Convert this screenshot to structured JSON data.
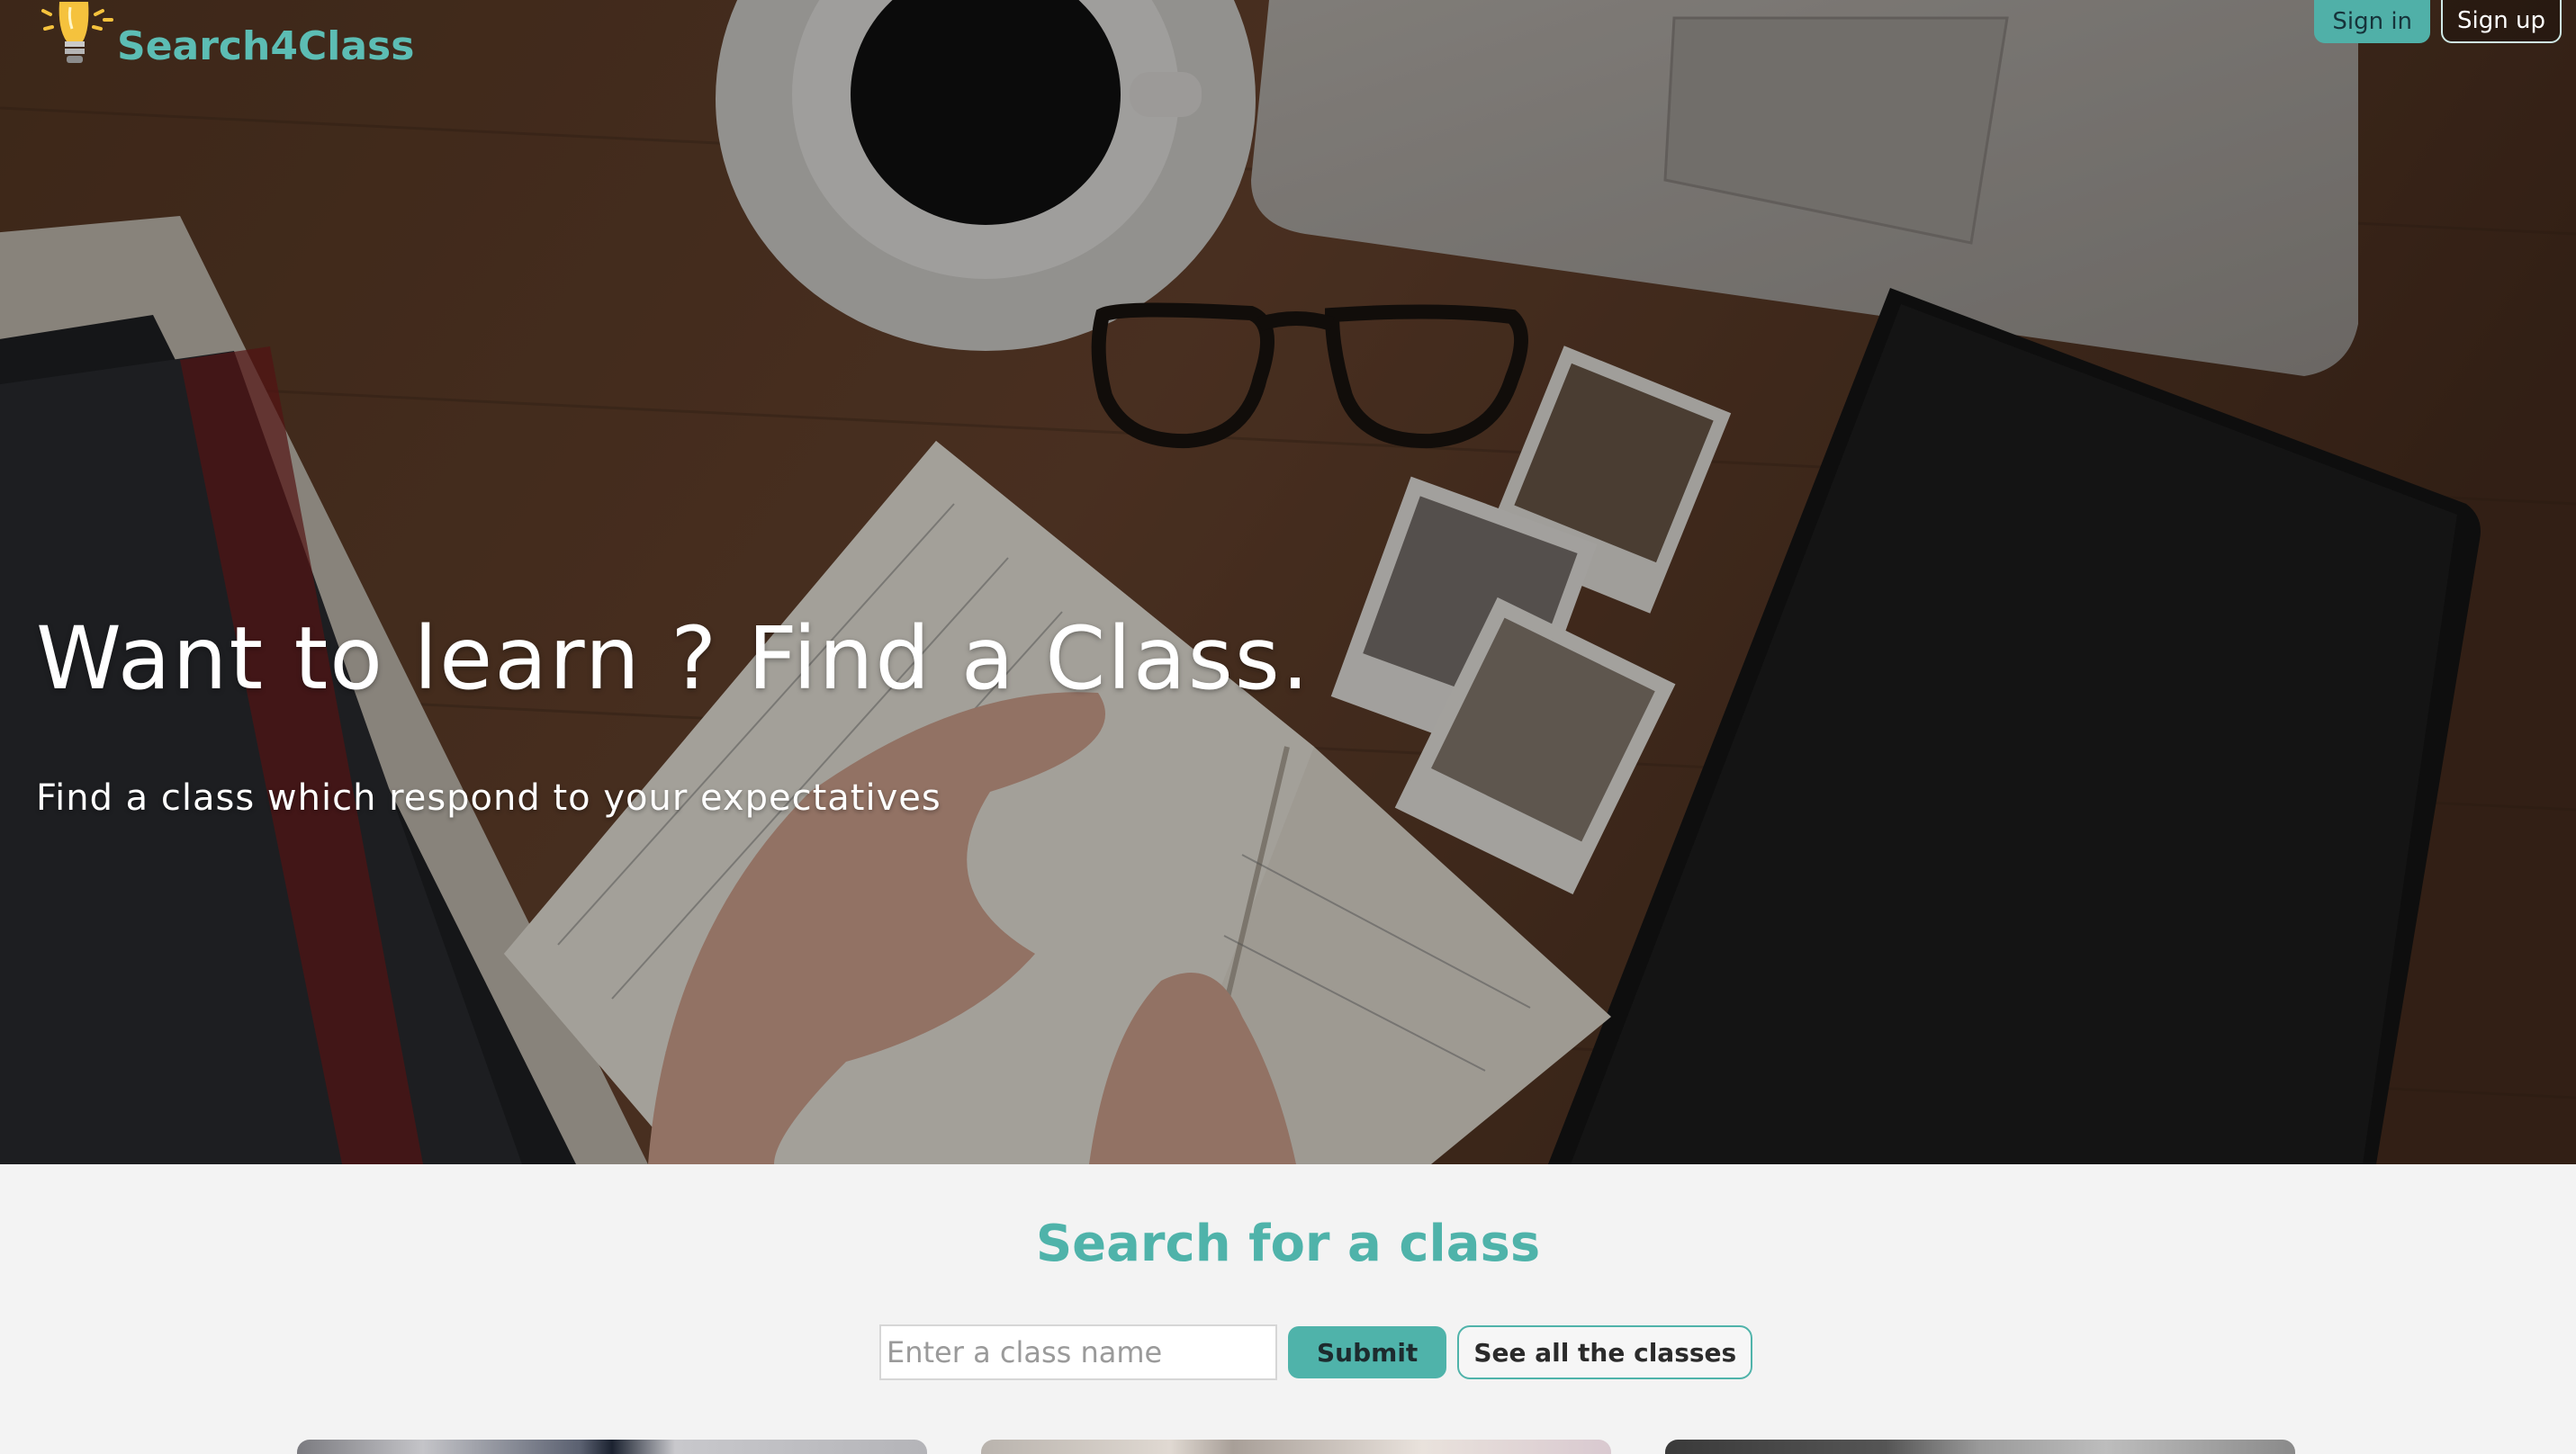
{
  "header": {
    "logo_text": "Search4Class",
    "logo_icon": "lightbulb-icon",
    "sign_in": "Sign in",
    "sign_up": "Sign up"
  },
  "hero": {
    "title": "Want to learn ? Find a Class.",
    "subtitle": "Find a class which respond to your expectatives"
  },
  "search": {
    "title": "Search for a class",
    "placeholder": "Enter a class name",
    "value": "",
    "submit_label": "Submit",
    "see_all_label": "See all the classes"
  },
  "colors": {
    "accent": "#4fb3aa",
    "logo": "#5cbdb4",
    "section_bg": "#f3f3f3"
  }
}
